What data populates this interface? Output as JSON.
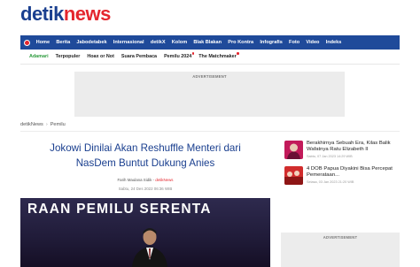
{
  "logo": {
    "part1": "detik",
    "part2": "news"
  },
  "nav": {
    "items": [
      "Home",
      "Berita",
      "Jabodetabek",
      "Internasional",
      "detikX",
      "Kolom",
      "Blak Blakan",
      "Pro Kontra",
      "Infografis",
      "Foto",
      "Video",
      "Indeks"
    ]
  },
  "subnav": {
    "items": [
      "Adamari",
      "Terpopuler",
      "Hoax or Not",
      "Suara Pembaca",
      "Pemilu 2024",
      "The Matchmaker"
    ]
  },
  "ads": {
    "top_label": "ADVERTISEMENT",
    "side_label": "ADVERTISEMENT"
  },
  "breadcrumb": {
    "root": "detikNews",
    "current": "Pemilu"
  },
  "article": {
    "headline_line1": "Jokowi Dinilai Akan Reshuffle Menteri dari",
    "headline_line2": "NasDem Buntut Dukung Anies",
    "author": "Farih Maulana Sidik",
    "source": "detikNews",
    "date": "Sabtu, 24 Des 2022 06:36 WIB",
    "image_banner_text": "RAAN PEMILU SERENTA"
  },
  "sidebar": {
    "items": [
      {
        "title": "Berakhirnya Sebuah Era, Kilas Balik Wafatnya Ratu Elizabeth II",
        "meta": "Sabtu, 07 Jan 2023 14:29 WIB"
      },
      {
        "title": "4 DOB Papua Diyakini Bisa Percepat Pemerataan...",
        "meta": "Selasa, 03 Jan 2023 21:20 WIB"
      }
    ]
  },
  "colors": {
    "brand_blue": "#1a3f8f",
    "brand_red": "#e4262e",
    "nav_blue": "#1f4a9a",
    "accent_green": "#2c9b3d"
  }
}
